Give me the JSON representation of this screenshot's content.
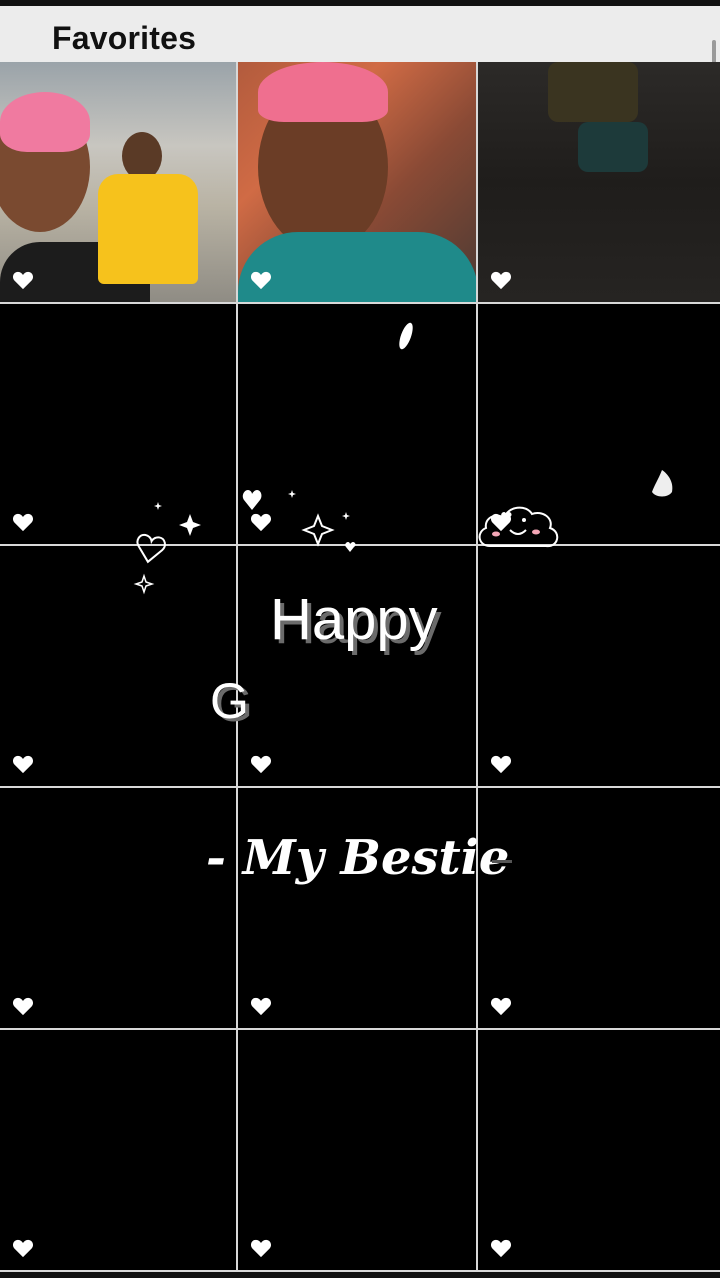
{
  "header": {
    "title": "Favorites"
  },
  "overlay": {
    "happy": "Happy",
    "letter": "G",
    "bestie": "- My Bestie"
  },
  "colors": {
    "header_bg": "#ececec",
    "heart": "#ffffff",
    "grid_line": "#d8d8d8"
  },
  "grid": {
    "columns": 3,
    "rows": 5,
    "cells": [
      {
        "kind": "photo",
        "subject": "two women selfie outdoors",
        "favorite": true
      },
      {
        "kind": "photo",
        "subject": "woman selfie pink hair",
        "favorite": true
      },
      {
        "kind": "photo",
        "subject": "person standing dark",
        "favorite": true
      },
      {
        "kind": "dark",
        "favorite": true
      },
      {
        "kind": "dark",
        "favorite": true
      },
      {
        "kind": "dark",
        "favorite": true
      },
      {
        "kind": "dark",
        "favorite": true
      },
      {
        "kind": "dark",
        "favorite": true
      },
      {
        "kind": "dark",
        "favorite": true
      },
      {
        "kind": "dark",
        "favorite": true
      },
      {
        "kind": "dark",
        "favorite": true
      },
      {
        "kind": "dark",
        "favorite": true
      },
      {
        "kind": "dark",
        "favorite": true
      },
      {
        "kind": "dark",
        "favorite": true
      },
      {
        "kind": "dark",
        "favorite": true
      }
    ]
  }
}
